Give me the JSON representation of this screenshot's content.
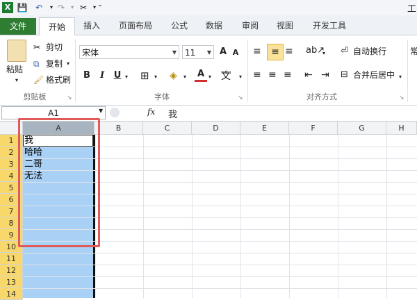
{
  "titlebar": {
    "title_fragment": "工"
  },
  "tabs": {
    "file": "文件",
    "home": "开始",
    "insert": "插入",
    "layout": "页面布局",
    "formula": "公式",
    "data": "数据",
    "review": "审阅",
    "view": "视图",
    "developer": "开发工具"
  },
  "clipboard": {
    "paste": "粘贴",
    "cut": "剪切",
    "copy": "复制",
    "painter": "格式刷",
    "group": "剪贴板"
  },
  "font": {
    "name": "宋体",
    "size": "11",
    "bold": "B",
    "italic": "I",
    "underline": "U",
    "grow": "A",
    "shrink": "A",
    "font_color": "A",
    "wen": "wén",
    "group": "字体"
  },
  "align": {
    "wrap": "自动换行",
    "merge": "合并后居中",
    "group": "对齐方式",
    "partial": "常"
  },
  "formula_bar": {
    "namebox": "A1",
    "fx": "fx",
    "value": "我"
  },
  "columns": [
    "A",
    "B",
    "C",
    "D",
    "E",
    "F",
    "G",
    "H"
  ],
  "rows": [
    "1",
    "2",
    "3",
    "4",
    "5",
    "6",
    "7",
    "8",
    "9",
    "10",
    "11",
    "12",
    "13",
    "14"
  ],
  "cells": {
    "A1": "我",
    "A2": "哈哈",
    "A3": "二哥",
    "A4": "无法"
  },
  "colors": {
    "file_tab": "#2e7d32",
    "selection": "#a9d0f5",
    "highlight_box": "#e05a5a",
    "row_header_selected": "#f8d86a"
  }
}
